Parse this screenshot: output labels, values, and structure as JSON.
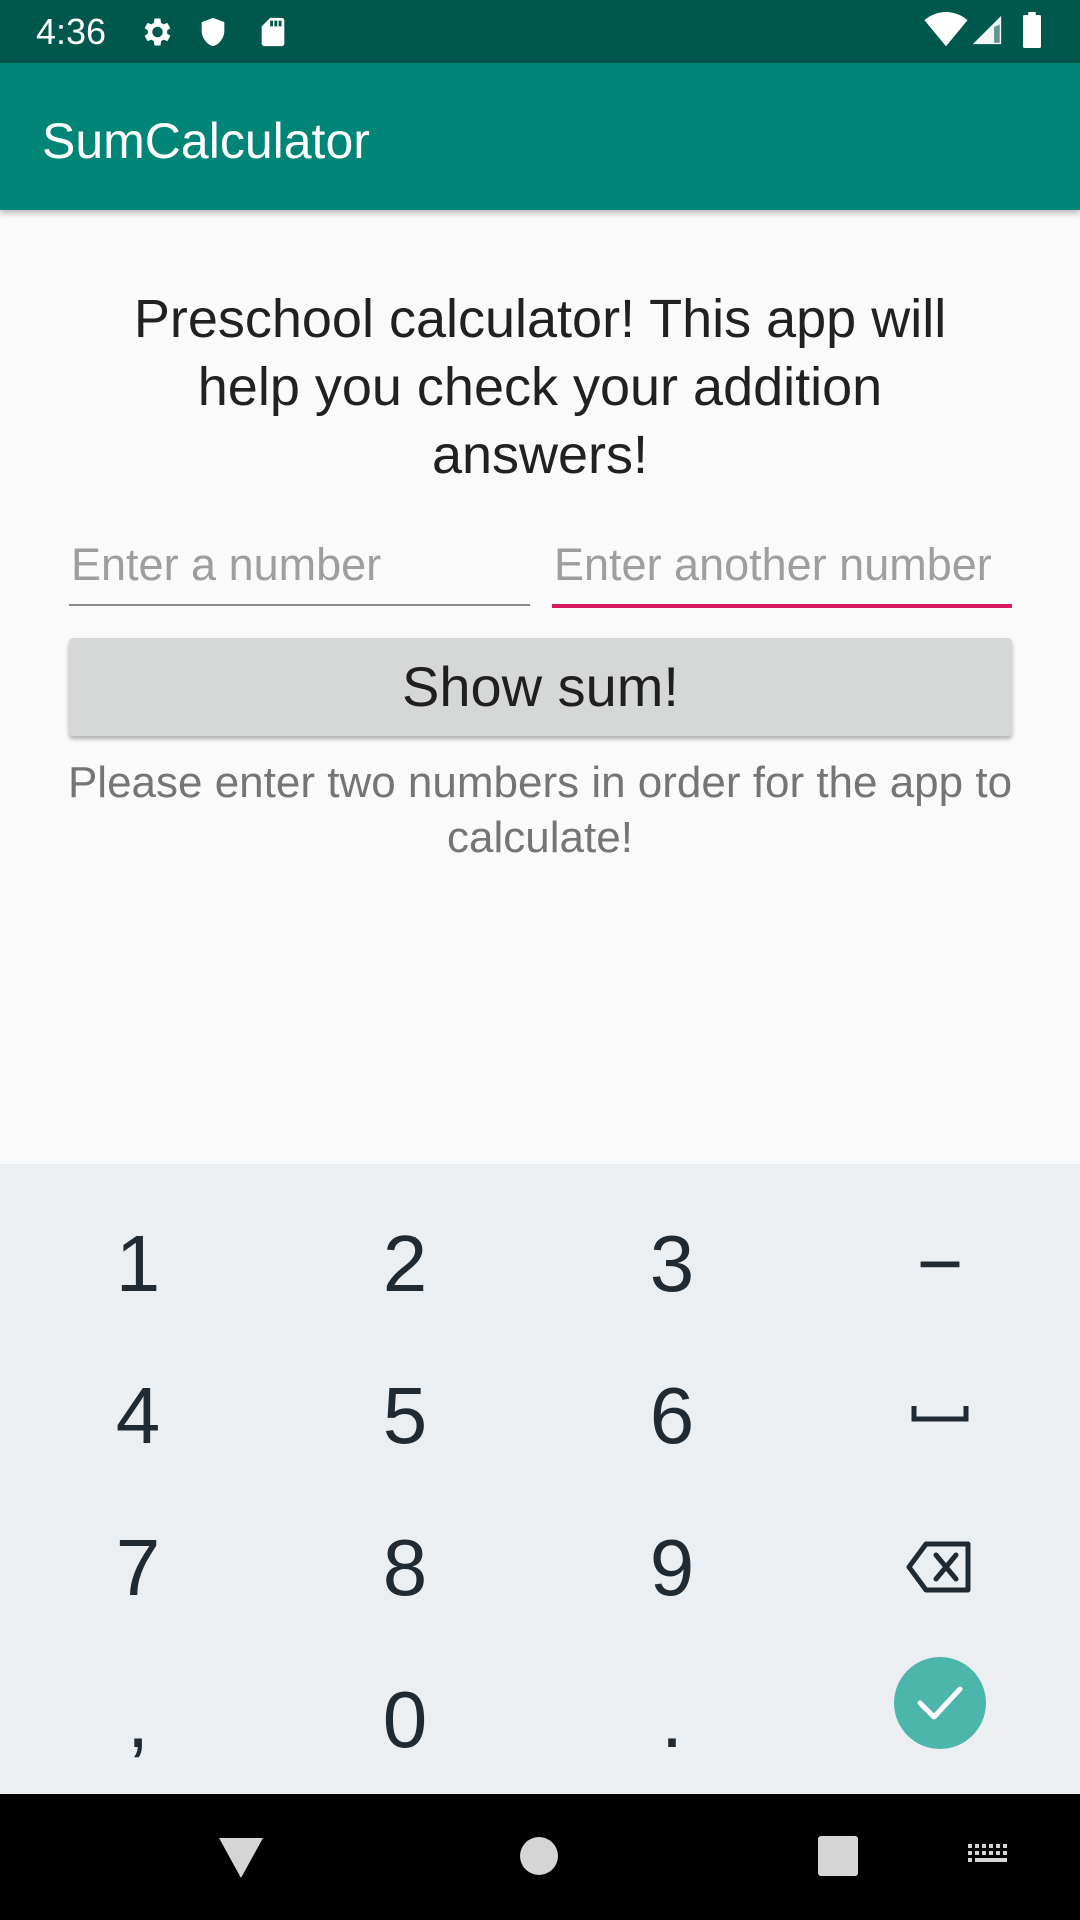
{
  "status_bar": {
    "time": "4:36",
    "icons_left": [
      "gear-icon",
      "shield-icon",
      "sd-card-icon"
    ],
    "icons_right": [
      "wifi-icon",
      "signal-icon",
      "battery-icon"
    ]
  },
  "app_bar": {
    "title": "SumCalculator",
    "color": "#008577"
  },
  "main": {
    "intro": "Preschool calculator! This app will help you check your addition answers!",
    "first_input": {
      "value": "",
      "placeholder": "Enter a number"
    },
    "second_input": {
      "value": "",
      "placeholder": "Enter another number",
      "focused": true
    },
    "show_sum_label": "Show sum!",
    "hint": "Please enter two numbers in order for the app to calculate!"
  },
  "keyboard": {
    "keys": [
      "1",
      "2",
      "3",
      "−",
      "4",
      "5",
      "6",
      "space-icon",
      "7",
      "8",
      "9",
      "backspace-icon",
      ",",
      "0",
      ".",
      "check-icon"
    ],
    "accent": "#4db6ac"
  },
  "nav_bar": {
    "buttons": [
      "back-icon",
      "home-icon",
      "recents-icon",
      "keyboard-switch-icon"
    ]
  }
}
